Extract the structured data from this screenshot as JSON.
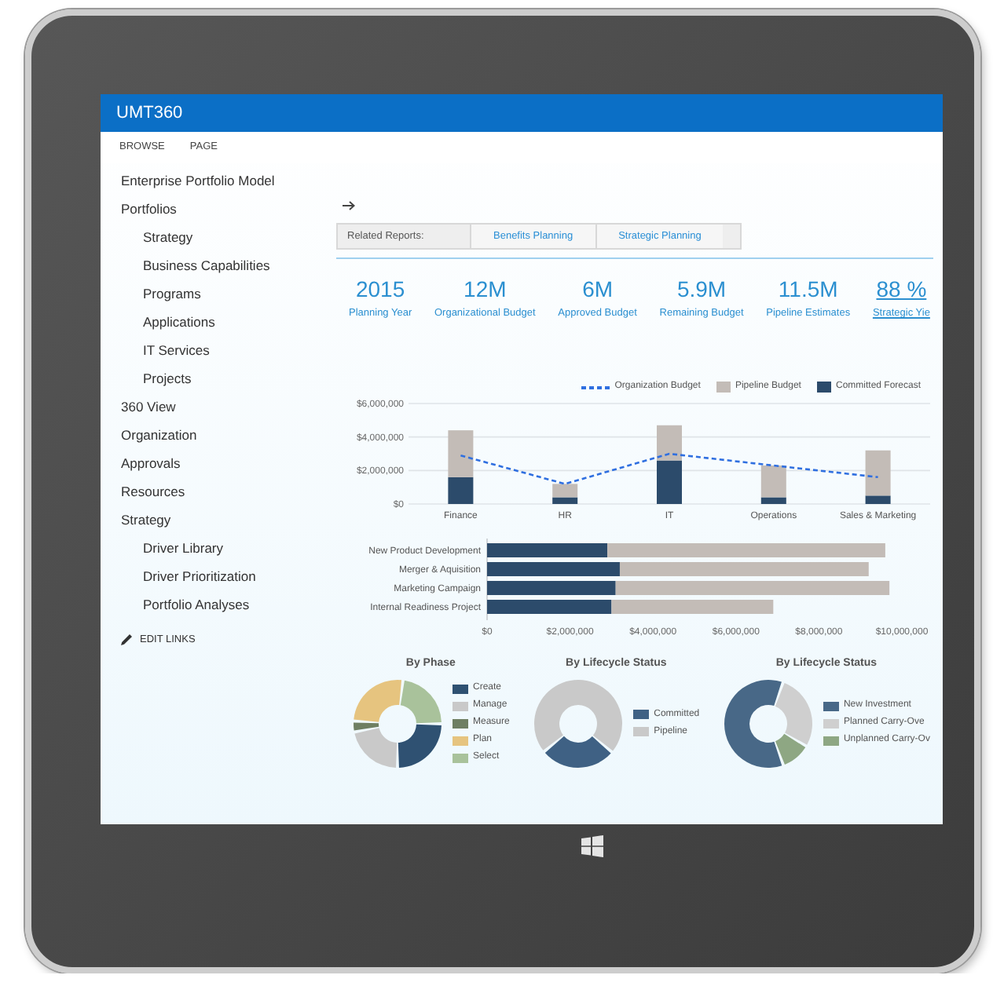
{
  "app": {
    "title": "UMT360"
  },
  "ribbon_tabs": [
    {
      "label": "BROWSE",
      "selected": false
    },
    {
      "label": "PAGE",
      "selected": false
    }
  ],
  "sidebar": {
    "items": [
      {
        "label": "Enterprise Portfolio Model"
      },
      {
        "label": "Portfolios",
        "children": [
          {
            "label": "Strategy"
          },
          {
            "label": "Business Capabilities"
          },
          {
            "label": "Programs"
          },
          {
            "label": "Applications"
          },
          {
            "label": "IT Services"
          },
          {
            "label": "Projects"
          }
        ]
      },
      {
        "label": "360 View"
      },
      {
        "label": "Organization"
      },
      {
        "label": "Approvals"
      },
      {
        "label": "Resources"
      },
      {
        "label": "Strategy",
        "children": [
          {
            "label": "Driver Library"
          },
          {
            "label": "Driver Prioritization"
          },
          {
            "label": "Portfolio Analyses"
          }
        ]
      }
    ],
    "edit_links": "EDIT LINKS"
  },
  "related_reports": {
    "label": "Related Reports:",
    "links": [
      "Benefits Planning",
      "Strategic Planning"
    ]
  },
  "kpis": [
    {
      "value": "2015",
      "label": "Planning Year",
      "kind": "plain"
    },
    {
      "value": "12M",
      "label": "Organizational Budget",
      "kind": "plain"
    },
    {
      "value": "6M",
      "label": "Approved Budget",
      "kind": "plain"
    },
    {
      "value": "5.9M",
      "label": "Remaining Budget",
      "kind": "plain"
    },
    {
      "value": "11.5M",
      "label": "Pipeline Estimates",
      "kind": "plain"
    },
    {
      "value": "88 %",
      "label": "Strategic Yie",
      "kind": "link"
    }
  ],
  "budget_chart": {
    "chart_data": {
      "type": "bar",
      "stacked": true,
      "legend": "top-right",
      "categories": [
        "Finance",
        "HR",
        "IT",
        "Operations",
        "Sales & Marketing"
      ],
      "series": [
        {
          "name": "Organization Budget",
          "type": "line",
          "line_style": "dashed",
          "color": "#2f6fe0",
          "values": [
            2900000,
            1200000,
            3000000,
            2300000,
            1600000
          ]
        },
        {
          "name": "Pipeline Budget",
          "type": "bar",
          "color": "#c3bcb7",
          "values": [
            2800000,
            800000,
            2100000,
            1900000,
            2700000
          ]
        },
        {
          "name": "Committed Forecast",
          "type": "bar",
          "color": "#2c4b6b",
          "values": [
            1600000,
            400000,
            2600000,
            400000,
            500000
          ]
        }
      ],
      "ylim": [
        0,
        6000000
      ],
      "yticks": [
        {
          "value": 0,
          "label": "$0"
        },
        {
          "value": 2000000,
          "label": "$2,000,000"
        },
        {
          "value": 4000000,
          "label": "$4,000,000"
        },
        {
          "value": 6000000,
          "label": "$6,000,000"
        }
      ]
    }
  },
  "project_chart": {
    "chart_data": {
      "type": "bar",
      "orientation": "horizontal",
      "stacked": true,
      "categories": [
        "New Product Development",
        "Merger & Aquisition",
        "Marketing Campaign",
        "Internal Readiness Project"
      ],
      "series": [
        {
          "color": "#2c4b6b",
          "values": [
            2900000,
            3200000,
            3100000,
            3000000
          ]
        },
        {
          "color": "#c3bcb7",
          "values": [
            6700000,
            6000000,
            6600000,
            3900000
          ]
        }
      ],
      "xlim": [
        0,
        10000000
      ],
      "xticks": [
        {
          "value": 0,
          "label": "$0"
        },
        {
          "value": 2000000,
          "label": "$2,000,000"
        },
        {
          "value": 4000000,
          "label": "$4,000,000"
        },
        {
          "value": 6000000,
          "label": "$6,000,000"
        },
        {
          "value": 8000000,
          "label": "$8,000,000"
        },
        {
          "value": 10000000,
          "label": "$10,000,000"
        }
      ]
    }
  },
  "donuts": [
    {
      "title": "By Phase",
      "legend": [
        {
          "label": "Create",
          "color": "#2f5172"
        },
        {
          "label": "Manage",
          "color": "#c9c9c9"
        },
        {
          "label": "Measure",
          "color": "#6f7f62"
        },
        {
          "label": "Plan",
          "color": "#e6c47f"
        },
        {
          "label": "Select",
          "color": "#a9c29b"
        }
      ]
    },
    {
      "title": "By Lifecycle Status",
      "legend": [
        {
          "label": "Committed",
          "color": "#3f6184"
        },
        {
          "label": "Pipeline",
          "color": "#c9c9c9"
        }
      ]
    },
    {
      "title": "By Lifecycle Status",
      "legend": [
        {
          "label": "New Investment",
          "color": "#486887"
        },
        {
          "label": "Planned Carry-Ove",
          "color": "#cfcfcf"
        },
        {
          "label": "Unplanned Carry-Ov",
          "color": "#8ea783"
        }
      ]
    }
  ]
}
